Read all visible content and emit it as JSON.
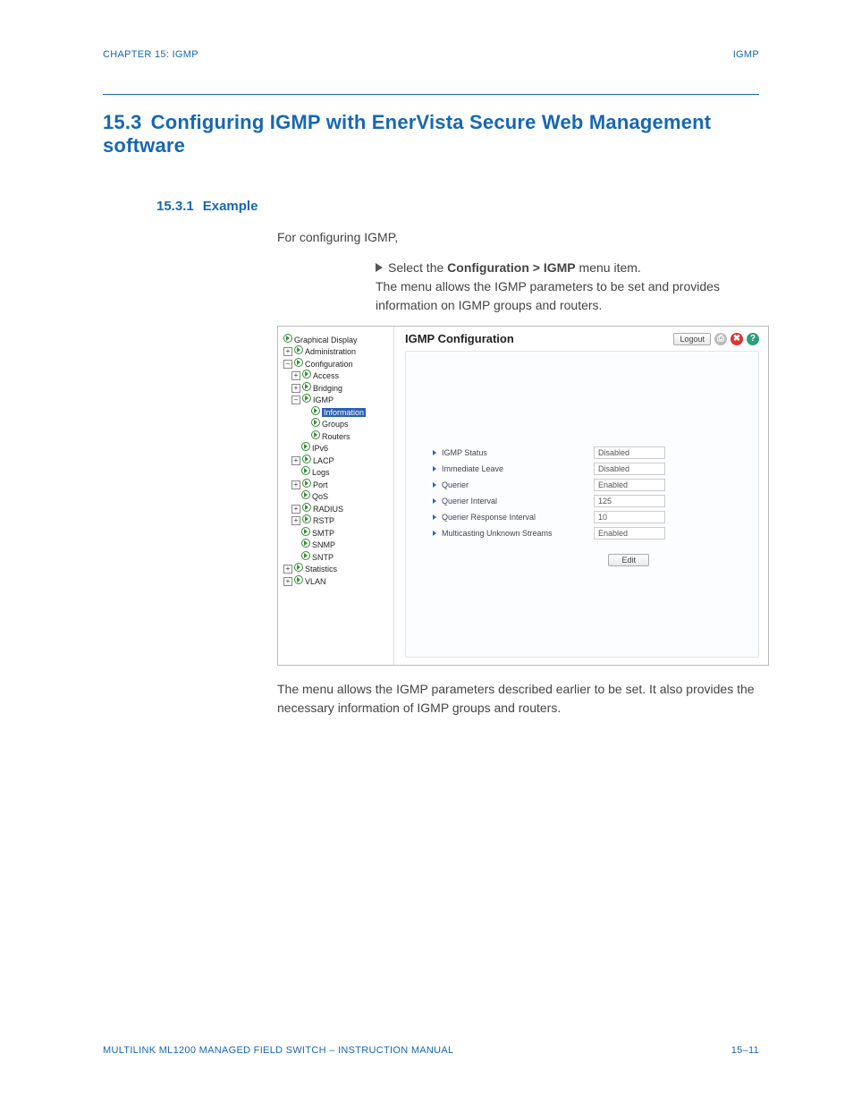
{
  "header": {
    "left": "CHAPTER 15: IGMP",
    "right": "IGMP"
  },
  "section": {
    "num": "15.3",
    "title": "Configuring IGMP with EnerVista Secure Web Management software"
  },
  "subsection": {
    "num": "15.3.1",
    "title": "Example"
  },
  "intro": "For configuring IGMP,",
  "step_prefix": "Select the ",
  "step_bold": "Configuration > IGMP",
  "step_suffix": " menu item.",
  "step_desc": "The menu allows the IGMP parameters to be set and provides information on IGMP groups and routers.",
  "after_text": "The menu allows the IGMP parameters described earlier to be set. It also provides the necessary information of IGMP groups and routers.",
  "screenshot": {
    "title": "IGMP Configuration",
    "logout": "Logout",
    "edit": "Edit",
    "tree": {
      "graphical_display": "Graphical Display",
      "administration": "Administration",
      "configuration": "Configuration",
      "access": "Access",
      "bridging": "Bridging",
      "igmp": "IGMP",
      "information": "Information",
      "groups": "Groups",
      "routers": "Routers",
      "ipv6": "IPv6",
      "lacp": "LACP",
      "logs": "Logs",
      "port": "Port",
      "qos": "QoS",
      "radius": "RADIUS",
      "rstp": "RSTP",
      "smtp": "SMTP",
      "snmp": "SNMP",
      "sntp": "SNTP",
      "statistics": "Statistics",
      "vlan": "VLAN"
    },
    "params": [
      {
        "label": "IGMP Status",
        "value": "Disabled"
      },
      {
        "label": "Immediate Leave",
        "value": "Disabled"
      },
      {
        "label": "Querier",
        "value": "Enabled"
      },
      {
        "label": "Querier Interval",
        "value": "125"
      },
      {
        "label": "Querier Response Interval",
        "value": "10"
      },
      {
        "label": "Multicasting Unknown Streams",
        "value": "Enabled"
      }
    ]
  },
  "footer": {
    "left": "MULTILINK ML1200 MANAGED FIELD SWITCH – INSTRUCTION MANUAL",
    "right": "15–11"
  }
}
